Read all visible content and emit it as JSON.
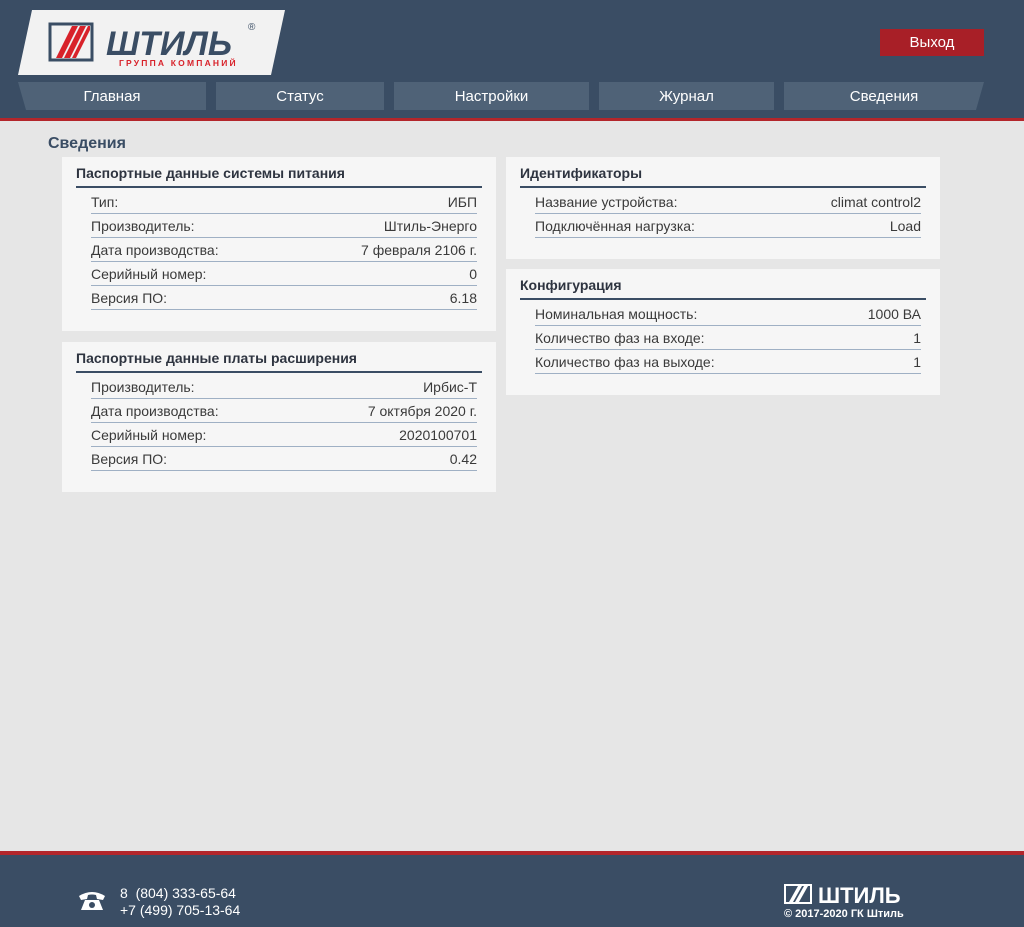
{
  "header": {
    "logo": {
      "brand": "ШТИЛЬ",
      "tagline": "ГРУППА КОМПАНИЙ",
      "registered": "®"
    },
    "logout_label": "Выход",
    "nav": [
      "Главная",
      "Статус",
      "Настройки",
      "Журнал",
      "Сведения"
    ]
  },
  "page": {
    "title": "Сведения"
  },
  "cards": {
    "power_system": {
      "title": "Паспортные данные системы питания",
      "rows": [
        {
          "label": "Тип:",
          "value": "ИБП"
        },
        {
          "label": "Производитель:",
          "value": "Штиль-Энерго"
        },
        {
          "label": "Дата производства:",
          "value": "7 февраля 2106 г."
        },
        {
          "label": "Серийный номер:",
          "value": "0"
        },
        {
          "label": "Версия ПО:",
          "value": "6.18"
        }
      ]
    },
    "expansion_board": {
      "title": "Паспортные данные платы расширения",
      "rows": [
        {
          "label": "Производитель:",
          "value": "Ирбис-Т"
        },
        {
          "label": "Дата производства:",
          "value": "7 октября 2020 г."
        },
        {
          "label": "Серийный номер:",
          "value": "2020100701"
        },
        {
          "label": "Версия ПО:",
          "value": "0.42"
        }
      ]
    },
    "identifiers": {
      "title": "Идентификаторы",
      "rows": [
        {
          "label": "Название устройства:",
          "value": "climat control2"
        },
        {
          "label": "Подключённая нагрузка:",
          "value": "Load"
        }
      ]
    },
    "configuration": {
      "title": "Конфигурация",
      "rows": [
        {
          "label": "Номинальная мощность:",
          "value": "1000 ВА"
        },
        {
          "label": "Количество фаз на входе:",
          "value": "1"
        },
        {
          "label": "Количество фаз на выходе:",
          "value": "1"
        }
      ]
    }
  },
  "footer": {
    "phones": [
      "8  (804) 333-65-64",
      "+7 (499) 705-13-64"
    ],
    "brand": "ШТИЛЬ",
    "copyright": "© 2017-2020 ГК Штиль",
    "icons": {
      "phone": "phone-icon"
    }
  },
  "colors": {
    "header_bg": "#3a4d64",
    "accent_red": "#b3262b",
    "logout_bg": "#a81f27",
    "nav_tab": "#4f6277",
    "card_bg": "#f6f6f6",
    "page_bg": "#e6e6e6"
  }
}
